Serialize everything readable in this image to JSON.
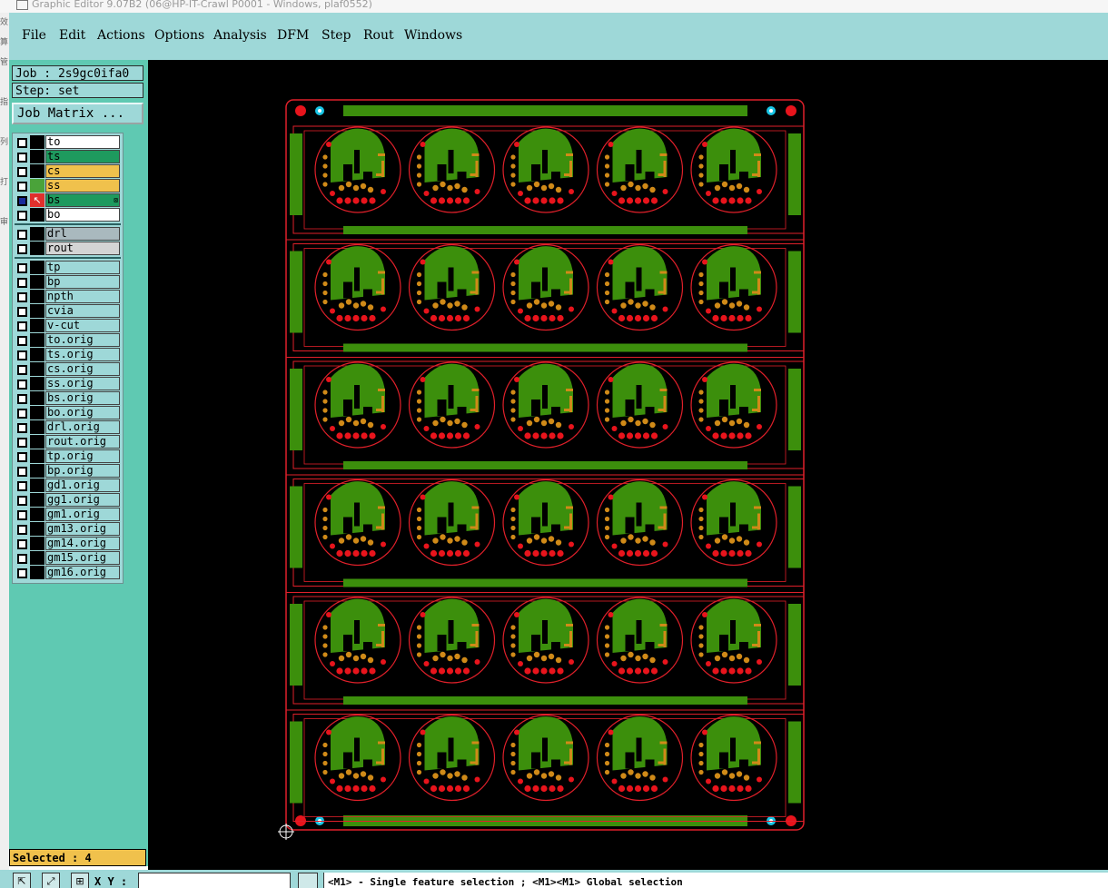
{
  "window": {
    "title": "Graphic Editor 9.07B2 (06@HP-IT-Crawl P0001 - Windows, plaf0552)"
  },
  "menu": [
    "File",
    "Edit",
    "Actions",
    "Options",
    "Analysis",
    "DFM",
    "Step",
    "Rout",
    "Windows"
  ],
  "left_strip_glyphs": [
    "效",
    "算",
    "管",
    "",
    "指",
    "",
    "列",
    "",
    "打",
    "",
    "审"
  ],
  "job": {
    "label": "Job : 2s9gc0ifa0",
    "step": "Step: set",
    "matrix_button": "Job Matrix ..."
  },
  "layer_groups": [
    [
      {
        "name": "to",
        "bg": "#ffffff",
        "swatch": "#000000",
        "checked": false
      },
      {
        "name": "ts",
        "bg": "#1e9a5e",
        "swatch": "#000000",
        "checked": false
      },
      {
        "name": "cs",
        "bg": "#f0c14c",
        "swatch": "#000000",
        "checked": false
      },
      {
        "name": "ss",
        "bg": "#f0c14c",
        "swatch": "#4aa33a",
        "checked": false
      },
      {
        "name": "bs",
        "bg": "#1e9a5e",
        "swatch": "#e0302c",
        "checked": true,
        "active": true,
        "mark": "⊠"
      },
      {
        "name": "bo",
        "bg": "#ffffff",
        "swatch": "#000000",
        "checked": false
      }
    ],
    [
      {
        "name": "drl",
        "bg": "#a9b9be",
        "swatch": "#000000",
        "checked": false
      },
      {
        "name": "rout",
        "bg": "#d4d4d4",
        "swatch": "#000000",
        "checked": false
      }
    ],
    [
      {
        "name": "tp",
        "bg": "#9ed8d8",
        "swatch": "#000000",
        "checked": false
      },
      {
        "name": "bp",
        "bg": "#9ed8d8",
        "swatch": "#000000",
        "checked": false
      },
      {
        "name": "npth",
        "bg": "#9ed8d8",
        "swatch": "#000000",
        "checked": false
      },
      {
        "name": "cvia",
        "bg": "#9ed8d8",
        "swatch": "#000000",
        "checked": false
      },
      {
        "name": "v-cut",
        "bg": "#9ed8d8",
        "swatch": "#000000",
        "checked": false
      },
      {
        "name": "to.orig",
        "bg": "#9ed8d8",
        "swatch": "#000000",
        "checked": false
      },
      {
        "name": "ts.orig",
        "bg": "#9ed8d8",
        "swatch": "#000000",
        "checked": false
      },
      {
        "name": "cs.orig",
        "bg": "#9ed8d8",
        "swatch": "#000000",
        "checked": false
      },
      {
        "name": "ss.orig",
        "bg": "#9ed8d8",
        "swatch": "#000000",
        "checked": false
      },
      {
        "name": "bs.orig",
        "bg": "#9ed8d8",
        "swatch": "#000000",
        "checked": false
      },
      {
        "name": "bo.orig",
        "bg": "#9ed8d8",
        "swatch": "#000000",
        "checked": false
      },
      {
        "name": "drl.orig",
        "bg": "#9ed8d8",
        "swatch": "#000000",
        "checked": false
      },
      {
        "name": "rout.orig",
        "bg": "#9ed8d8",
        "swatch": "#000000",
        "checked": false
      },
      {
        "name": "tp.orig",
        "bg": "#9ed8d8",
        "swatch": "#000000",
        "checked": false
      },
      {
        "name": "bp.orig",
        "bg": "#9ed8d8",
        "swatch": "#000000",
        "checked": false
      },
      {
        "name": "gd1.orig",
        "bg": "#9ed8d8",
        "swatch": "#000000",
        "checked": false
      },
      {
        "name": "gg1.orig",
        "bg": "#9ed8d8",
        "swatch": "#000000",
        "checked": false
      },
      {
        "name": "gm1.orig",
        "bg": "#9ed8d8",
        "swatch": "#000000",
        "checked": false
      },
      {
        "name": "gm13.orig",
        "bg": "#9ed8d8",
        "swatch": "#000000",
        "checked": false
      },
      {
        "name": "gm14.orig",
        "bg": "#9ed8d8",
        "swatch": "#000000",
        "checked": false
      },
      {
        "name": "gm15.orig",
        "bg": "#9ed8d8",
        "swatch": "#000000",
        "checked": false
      },
      {
        "name": "gm16.orig",
        "bg": "#9ed8d8",
        "swatch": "#000000",
        "checked": false
      }
    ]
  ],
  "selection": {
    "label": "Selected : 4"
  },
  "coords": {
    "label": "X Y :",
    "value": ""
  },
  "status": {
    "hint": "<M1> - Single feature selection ; <M1><M1> Global selection"
  },
  "board": {
    "rows": 6,
    "cols": 5
  },
  "colors": {
    "outline": "#e0202a",
    "copper": "#3c8f0c",
    "pad_red": "#e8141c",
    "pad_orange": "#d08a18",
    "fiducial": "#19c6e6",
    "canvas": "#000000"
  }
}
